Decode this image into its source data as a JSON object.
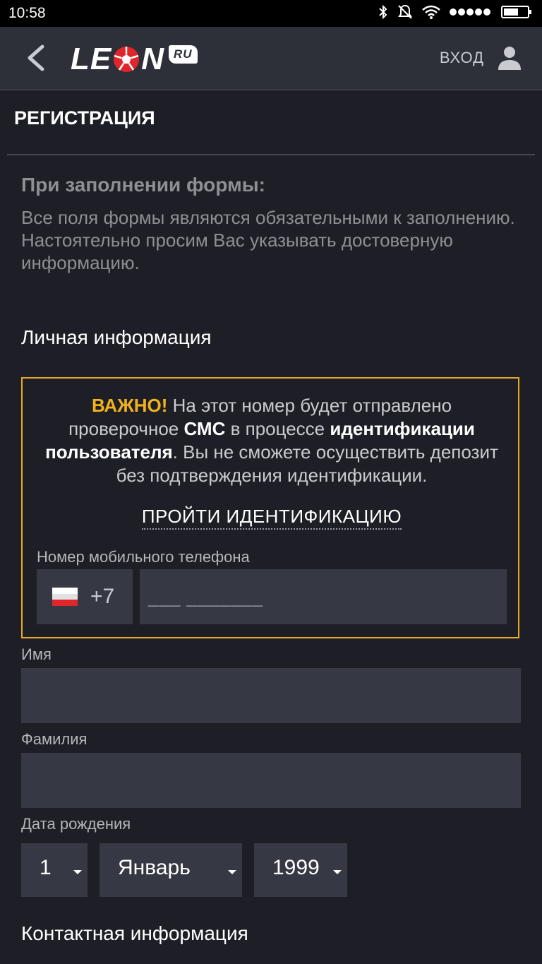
{
  "status_bar": {
    "time": "10:58",
    "icons": [
      "bluetooth-icon",
      "mute-icon",
      "wifi-icon",
      "signal-dots-icon",
      "battery-icon"
    ]
  },
  "header": {
    "logo_text_left": "LE",
    "logo_text_right": "N",
    "logo_badge": "RU",
    "login_label": "ВХОД"
  },
  "page": {
    "title": "РЕГИСТРАЦИЯ",
    "notice_title": "При заполнении формы:",
    "notice_line1": "Все поля формы являются обязательными к заполнению.",
    "notice_line2": "Настоятельно просим Вас указывать достоверную информацию."
  },
  "personal": {
    "section_title": "Личная информация",
    "important": {
      "warn": "ВАЖНО!",
      "t1": " На этот номер будет отправлено проверочное ",
      "b1": "СМС",
      "t2": " в процессе ",
      "b2": "идентификации пользователя",
      "t3": ". Вы не сможете осуществить депозит без подтверждения идентификации."
    },
    "ident_link": "ПРОЙТИ ИДЕНТИФИКАЦИЮ",
    "phone_label": "Номер мобильного телефона",
    "phone_prefix": "+7",
    "phone_placeholder": "___ _______",
    "first_name_label": "Имя",
    "first_name_value": "",
    "last_name_label": "Фамилия",
    "last_name_value": "",
    "birth_label": "Дата рождения",
    "birth_day": "1",
    "birth_month": "Январь",
    "birth_year": "1999"
  },
  "contact": {
    "section_title": "Контактная информация"
  },
  "colors": {
    "accent_warning": "#f2b21b",
    "border_warning": "#e8a825",
    "background": "#1e1f26",
    "input_bg": "#363943",
    "logo_red": "#e0262b"
  }
}
